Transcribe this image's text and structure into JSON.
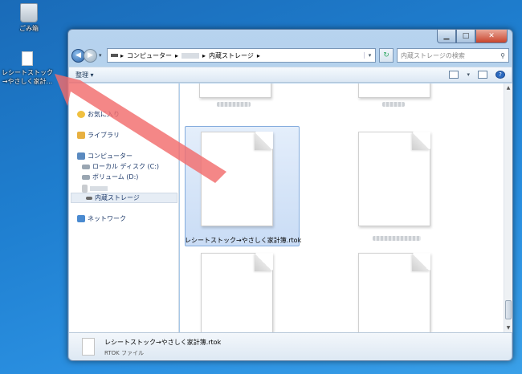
{
  "desktop": {
    "recycle_bin_label": "ごみ箱",
    "file_label": "レシートストック→やさしく家計...",
    "file_label_line1": "レシートストック",
    "file_label_line2": "→やさしく家計..."
  },
  "window": {
    "nav": {
      "back_icon": "back-arrow-icon",
      "forward_icon": "forward-arrow-icon"
    },
    "address": {
      "segments": [
        "コンピューター",
        "内蔵ストレージ"
      ],
      "separator": "▸"
    },
    "search_placeholder": "内蔵ストレージの検索",
    "toolbar": {
      "organize_label": "整理 ▾"
    },
    "nav_pane": {
      "favorites": "お気に入り",
      "libraries": "ライブラリ",
      "computer": "コンピューター",
      "local_disk": "ローカル ディスク (C:)",
      "volume": "ボリューム (D:)",
      "internal_storage": "内蔵ストレージ",
      "network": "ネットワーク"
    },
    "files": {
      "selected_name": "レシートストック→やさしく家計簿.rtok"
    },
    "details": {
      "name": "レシートストック→やさしく家計簿.rtok",
      "type": "RTOK ファイル"
    }
  },
  "colors": {
    "arrow": "#f26d6d",
    "selection": "#c9dcf5",
    "desktop": "#1f7fd0"
  }
}
